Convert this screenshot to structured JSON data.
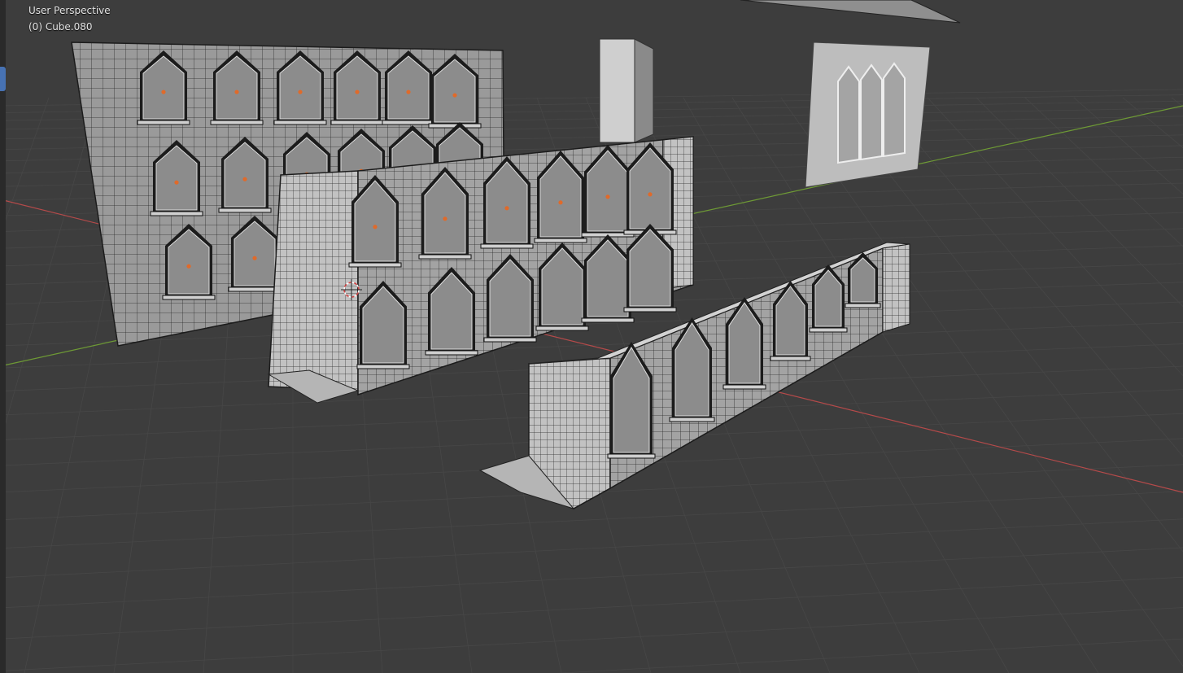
{
  "viewport": {
    "mode_label": "User Perspective",
    "object_label": "(0) Cube.080"
  },
  "colors": {
    "background": "#3d3d3d",
    "grid": "#464646",
    "x_axis": "#b54a4a",
    "y_axis": "#6e9a35",
    "mesh_face": "#9a9a9a",
    "mesh_light": "#c8c8c8",
    "wire": "#222222",
    "vertex": "#e06a2a",
    "active_tool": "#4772b3"
  },
  "icons": {
    "cursor": "3d-cursor-icon"
  }
}
